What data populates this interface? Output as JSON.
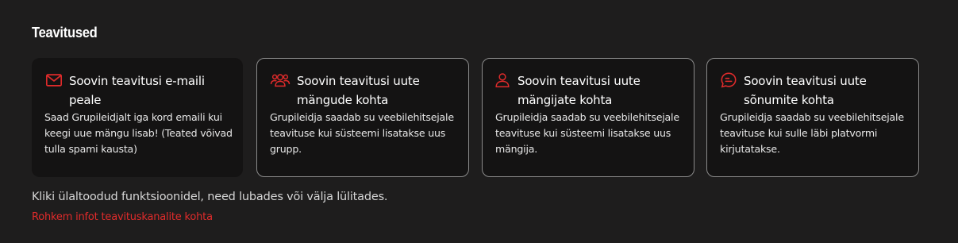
{
  "section": {
    "title": "Teavitused"
  },
  "cards": [
    {
      "icon": "envelope-icon",
      "title": "Soovin teavitusi e-maili peale",
      "description": "Saad Grupileidjalt iga kord emaili kui keegi uue mängu lisab! (Teated võivad tulla spami kausta)",
      "enabled": true
    },
    {
      "icon": "users-group-icon",
      "title": "Soovin teavitusi uute mängude kohta",
      "description": "Grupileidja saadab su veebilehitsejale teavituse kui süsteemi lisatakse uus grupp.",
      "enabled": false
    },
    {
      "icon": "user-icon",
      "title": "Soovin teavitusi uute mängijate kohta",
      "description": "Grupileidja saadab su veebilehitsejale teavituse kui süsteemi lisatakse uus mängija.",
      "enabled": false
    },
    {
      "icon": "message-bubble-icon",
      "title": "Soovin teavitusi uute sõnumite kohta",
      "description": "Grupileidja saadab su veebilehitsejale teavituse kui sulle läbi platvormi kirjutatakse.",
      "enabled": false
    }
  ],
  "hint": "Kliki ülaltoodud funktsioonidel, need lubades või välja lülitades.",
  "more_link": "Rohkem infot teavituskanalite kohta",
  "colors": {
    "background": "#1e1d1d",
    "card_background": "#141313",
    "card_border": "#8a8a8a",
    "accent": "#e02b2b"
  }
}
